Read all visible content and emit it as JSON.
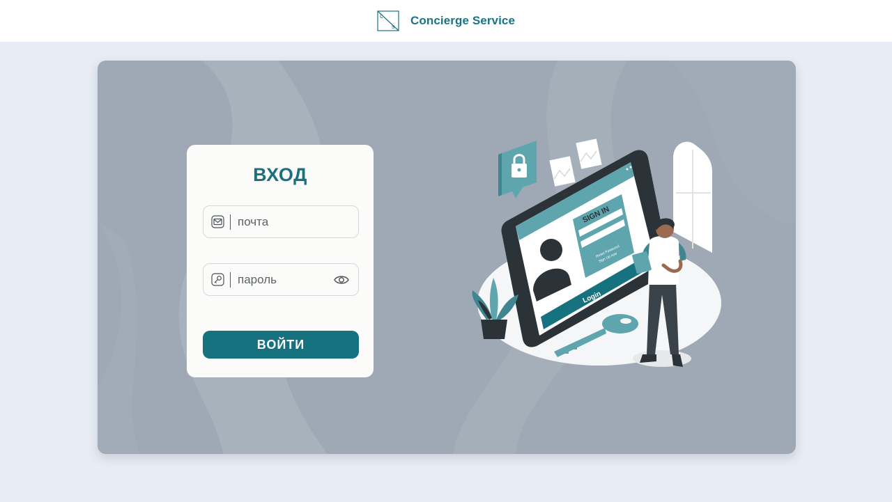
{
  "header": {
    "brand_name": "Concierge Service",
    "logo_letters": [
      "c",
      "s"
    ],
    "logo_icon": "cs-logo-icon"
  },
  "login_card": {
    "title": "ВХОД",
    "email": {
      "placeholder": "почта",
      "value": "",
      "icon": "mail-icon"
    },
    "password": {
      "placeholder": "пароль",
      "value": "",
      "icon": "key-icon",
      "toggle_icon": "eye-icon"
    },
    "submit_label": "ВОЙТИ"
  },
  "illustration": {
    "screen_heading": "SIGN IN",
    "screen_links": [
      "Reset Password",
      "Sign Up now"
    ],
    "screen_button": "Login"
  },
  "colors": {
    "accent": "#17727f",
    "brand_text": "#1d7382",
    "page_bg": "#e8ecf4",
    "panel_bg": "#9ea9b5",
    "card_bg": "#fbfcfa"
  }
}
